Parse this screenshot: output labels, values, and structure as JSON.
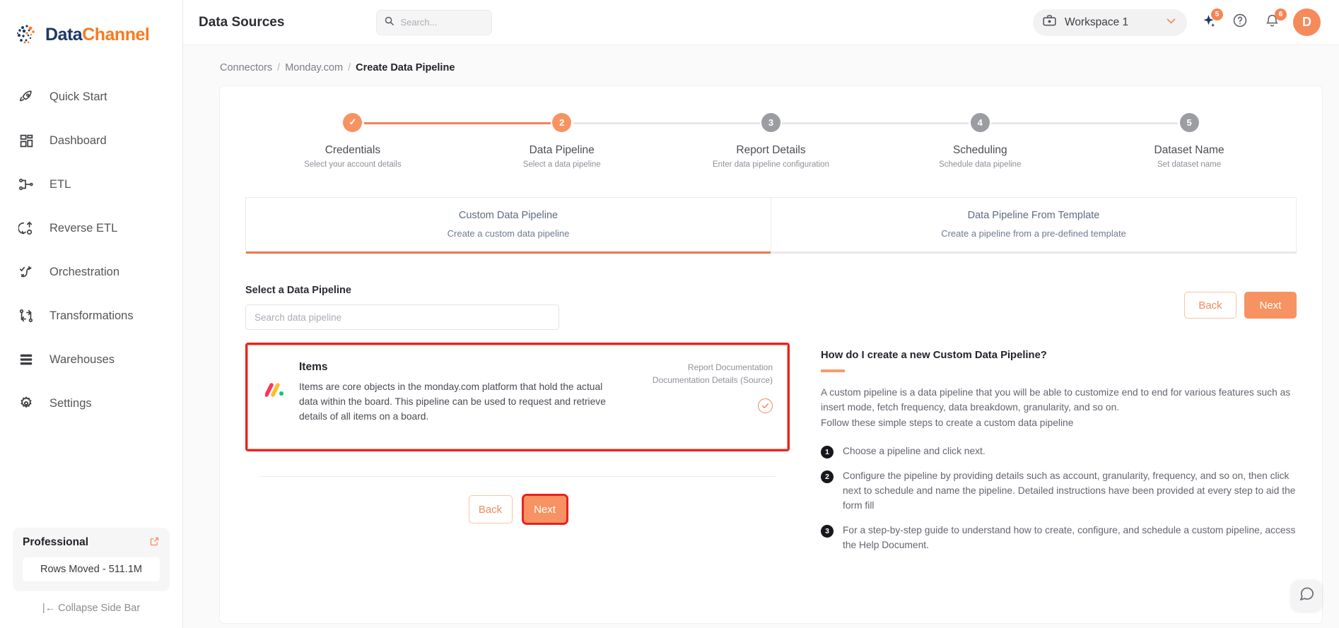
{
  "brand": {
    "logo_text_primary": "Data",
    "logo_text_accent": "Channel",
    "accent_color": "#f79362",
    "highlight_color": "#ee2020"
  },
  "sidebar": {
    "items": [
      {
        "label": "Quick Start",
        "icon": "rocket-icon"
      },
      {
        "label": "Dashboard",
        "icon": "grid-icon"
      },
      {
        "label": "ETL",
        "icon": "etl-icon"
      },
      {
        "label": "Reverse ETL",
        "icon": "reverse-etl-icon"
      },
      {
        "label": "Orchestration",
        "icon": "orchestration-icon"
      },
      {
        "label": "Transformations",
        "icon": "transformations-icon"
      },
      {
        "label": "Warehouses",
        "icon": "warehouse-icon"
      },
      {
        "label": "Settings",
        "icon": "gear-icon"
      }
    ],
    "plan": {
      "title": "Professional",
      "external_icon": "external-link-icon",
      "rows_moved": "Rows Moved - 511.1M"
    },
    "collapse": "|← Collapse Side Bar"
  },
  "topbar": {
    "title": "Data Sources",
    "search_placeholder": "Search...",
    "search_value": "",
    "search_icon": "search-icon",
    "workspace": {
      "label": "Workspace 1",
      "icon": "briefcase-icon",
      "caret": "chevron-down-icon"
    },
    "sparkle": {
      "icon": "sparkle-icon",
      "badge": "5"
    },
    "help": {
      "icon": "question-circle-icon"
    },
    "notifications": {
      "icon": "bell-icon",
      "badge": "6"
    },
    "avatar": {
      "initial": "D"
    }
  },
  "breadcrumb": {
    "items": [
      {
        "label": "Connectors",
        "current": false
      },
      {
        "label": "Monday.com",
        "current": false
      },
      {
        "label": "Create Data Pipeline",
        "current": true
      }
    ],
    "separator": "/"
  },
  "stepper": {
    "steps": [
      {
        "num": "1",
        "state": "done",
        "mark": "✓",
        "title": "Credentials",
        "sub": "Select your account details"
      },
      {
        "num": "2",
        "state": "active",
        "mark": "2",
        "title": "Data Pipeline",
        "sub": "Select a data pipeline"
      },
      {
        "num": "3",
        "state": "pending",
        "mark": "3",
        "title": "Report Details",
        "sub": "Enter data pipeline configuration"
      },
      {
        "num": "4",
        "state": "pending",
        "mark": "4",
        "title": "Scheduling",
        "sub": "Schedule data pipeline"
      },
      {
        "num": "5",
        "state": "pending",
        "mark": "5",
        "title": "Dataset Name",
        "sub": "Set dataset name"
      }
    ]
  },
  "tabs": [
    {
      "title": "Custom Data Pipeline",
      "sub": "Create a custom data pipeline",
      "active": true
    },
    {
      "title": "Data Pipeline From Template",
      "sub": "Create a pipeline from a pre-defined template",
      "active": false
    }
  ],
  "main": {
    "section_label": "Select a Data Pipeline",
    "search_placeholder": "Search data pipeline",
    "search_value": "",
    "buttons_top": {
      "back": "Back",
      "next": "Next"
    },
    "buttons_bottom": {
      "back": "Back",
      "next": "Next"
    },
    "pipeline_card": {
      "icon": "monday-logo-icon",
      "title": "Items",
      "description": "Items are core objects in the monday.com platform that hold the actual data within the board. This pipeline can be used to request and retrieve details of all items on a board.",
      "doc_link_1": "Report Documentation",
      "doc_link_2": "Documentation Details (Source)",
      "selected_icon": "check-circle-icon",
      "selected": true
    }
  },
  "help": {
    "title": "How do I create a new Custom Data Pipeline?",
    "paragraph": "A custom pipeline is a data pipeline that you will be able to customize end to end for various features such as insert mode, fetch frequency, data breakdown, granularity, and so on.\nFollow these simple steps to create a custom data pipeline",
    "steps": [
      {
        "num": "1",
        "text": "Choose a pipeline and click next."
      },
      {
        "num": "2",
        "text": "Configure the pipeline by providing details such as account, granularity, frequency, and so on, then click next to schedule and name the pipeline. Detailed instructions have been provided at every step to aid the form fill"
      },
      {
        "num": "3",
        "text": "For a step-by-step guide to understand how to create, configure, and schedule a custom pipeline, access the Help Document."
      }
    ]
  },
  "chat": {
    "icon": "chat-bubble-icon"
  }
}
